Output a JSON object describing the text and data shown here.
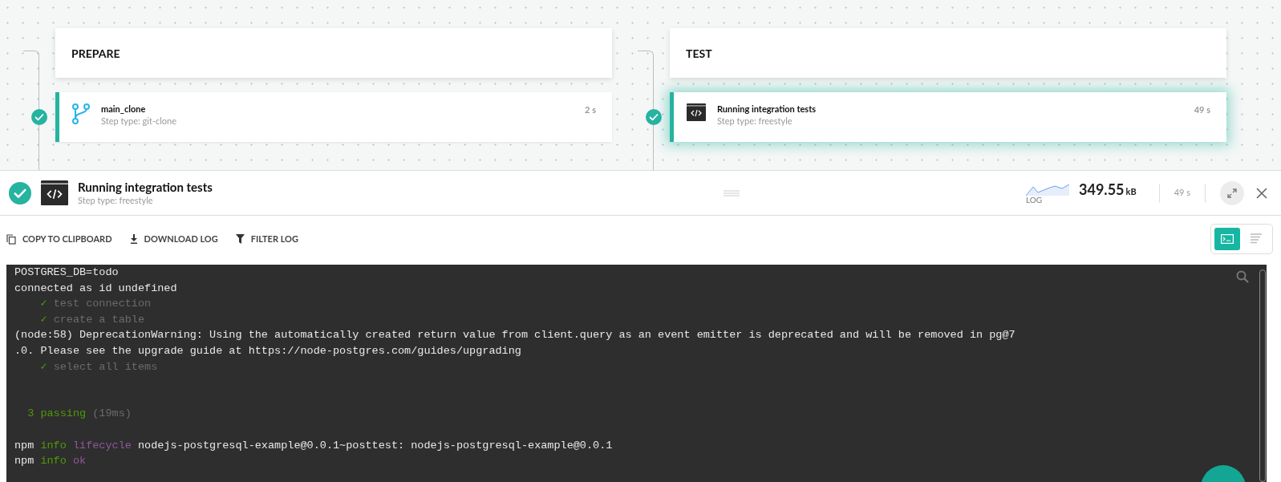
{
  "stages": [
    {
      "title": "PREPARE",
      "steps": [
        {
          "name": "main_clone",
          "type": "Step type: git-clone",
          "duration": "2 s",
          "kind": "git",
          "succeeded": true,
          "selected": false
        }
      ]
    },
    {
      "title": "TEST",
      "steps": [
        {
          "name": "Running integration tests",
          "type": "Step type: freestyle",
          "duration": "49 s",
          "kind": "freestyle",
          "succeeded": true,
          "selected": true
        }
      ]
    }
  ],
  "detail": {
    "succeeded": true,
    "title": "Running integration tests",
    "subtitle": "Step type: freestyle",
    "log_label": "LOG",
    "size": "349.55",
    "unit": "kB",
    "duration": "49 s"
  },
  "toolbar": [
    {
      "label": "COPY TO CLIPBOARD",
      "kind": "copy"
    },
    {
      "label": "DOWNLOAD LOG",
      "kind": "download"
    },
    {
      "label": "FILTER LOG",
      "kind": "filter"
    }
  ],
  "views": [
    {
      "kind": "terminal",
      "selected": true
    },
    {
      "kind": "text",
      "selected": false
    }
  ],
  "log": [
    {
      "kind": "text",
      "segments": [
        {
          "text": "POSTGRES_DB=todo",
          "color": "#e8e8e8"
        }
      ]
    },
    {
      "kind": "text",
      "segments": [
        {
          "text": "connected as id undefined",
          "color": "#e8e8e8"
        }
      ]
    },
    {
      "kind": "text",
      "segments": [
        {
          "text": "    ✓",
          "color": "#4e9a06"
        },
        {
          "text": " test connection",
          "color": "#6b6b6b"
        }
      ]
    },
    {
      "kind": "text",
      "segments": [
        {
          "text": "    ✓",
          "color": "#4e9a06"
        },
        {
          "text": " create a table",
          "color": "#6b6b6b"
        }
      ]
    },
    {
      "kind": "text",
      "segments": [
        {
          "text": "(node:58) DeprecationWarning: Using the automatically created return value from client.query as an event emitter is deprecated and will be removed in pg@7",
          "color": "#e8e8e8"
        }
      ]
    },
    {
      "kind": "text",
      "segments": [
        {
          "text": ".0. Please see the upgrade guide at https://node-postgres.com/guides/upgrading",
          "color": "#e8e8e8"
        }
      ]
    },
    {
      "kind": "text",
      "segments": [
        {
          "text": "    ✓",
          "color": "#4e9a06"
        },
        {
          "text": " select all items",
          "color": "#6b6b6b"
        }
      ]
    },
    {
      "kind": "blank"
    },
    {
      "kind": "blank"
    },
    {
      "kind": "text",
      "segments": [
        {
          "text": "  3 passing",
          "color": "#4e9a06"
        },
        {
          "text": " (19ms)",
          "color": "#6b6b6b"
        }
      ]
    },
    {
      "kind": "blank"
    },
    {
      "kind": "text",
      "segments": [
        {
          "text": "npm",
          "color": "#e8e8e8"
        },
        {
          "text": " info",
          "color": "#4e9a06"
        },
        {
          "text": " lifecycle",
          "color": "#8e5a9a"
        },
        {
          "text": " nodejs-postgresql-example@0.0.1~posttest: nodejs-postgresql-example@0.0.1",
          "color": "#e8e8e8"
        }
      ]
    },
    {
      "kind": "text",
      "segments": [
        {
          "text": "npm",
          "color": "#e8e8e8"
        },
        {
          "text": " info",
          "color": "#4e9a06"
        },
        {
          "text": " ok",
          "color": "#8e5a9a"
        }
      ]
    }
  ]
}
